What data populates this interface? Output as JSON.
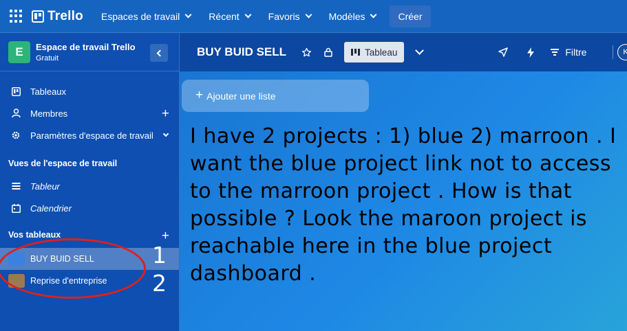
{
  "topbar": {
    "logo": "Trello",
    "nav": [
      {
        "label": "Espaces de travail"
      },
      {
        "label": "Récent"
      },
      {
        "label": "Favoris"
      },
      {
        "label": "Modèles"
      }
    ],
    "create_label": "Créer",
    "bg_color": "#1565c0"
  },
  "sidebar": {
    "workspace_initial": "E",
    "workspace_title": "Espace de travail Trello",
    "workspace_plan": "Gratuit",
    "items": [
      {
        "label": "Tableaux",
        "icon": "board-icon"
      },
      {
        "label": "Membres",
        "icon": "person-icon"
      },
      {
        "label": "Paramètres d'espace de travail",
        "icon": "gear-icon"
      }
    ],
    "views_heading": "Vues de l'espace de travail",
    "views": [
      {
        "label": "Tableur",
        "icon": "table-icon"
      },
      {
        "label": "Calendrier",
        "icon": "calendar-icon"
      }
    ],
    "boards_heading": "Vos tableaux",
    "boards": [
      {
        "label": "BUY BUID SELL",
        "color": "#3b82e0",
        "active": true
      },
      {
        "label": "Reprise d'entreprise",
        "color": "#9b7a52",
        "active": false
      }
    ]
  },
  "annotations": {
    "num1": "1",
    "num2": "2",
    "question": "I have 2 projects : 1) blue 2) marroon . I want the blue project link not to access to the marroon project . How is that possible ? Look the maroon project is reachable here in the blue project dashboard ."
  },
  "board": {
    "title": "BUY BUID SELL",
    "view_label": "Tableau",
    "filter_label": "Filtre",
    "user_initial": "K",
    "add_list_label": "Ajouter une liste"
  }
}
